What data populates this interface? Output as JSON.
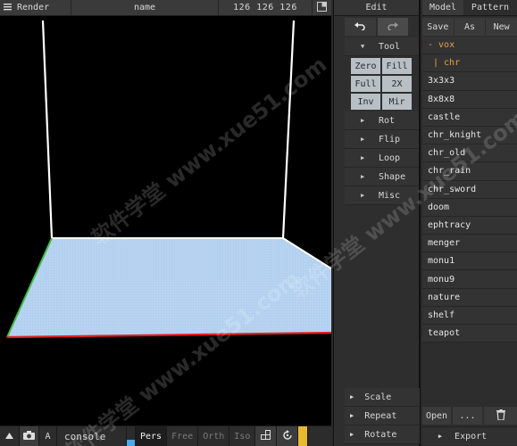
{
  "topbar": {
    "render_label": "Render",
    "name_label": "name",
    "dims": "126 126 126"
  },
  "bottombar": {
    "a_label": "A",
    "console_label": "console",
    "modes": [
      "Pers",
      "Free",
      "Orth",
      "Iso"
    ],
    "active_mode": "Pers"
  },
  "tools": {
    "title": "Edit",
    "tool_section": "Tool",
    "tool_buttons": [
      "Zero",
      "Fill",
      "Full",
      "2X",
      "Inv",
      "Mir"
    ],
    "sections": [
      "Rot",
      "Flip",
      "Loop",
      "Shape",
      "Misc"
    ],
    "bottom_sections": [
      "Scale",
      "Repeat",
      "Rotate"
    ]
  },
  "models": {
    "tab_model": "Model",
    "tab_pattern": "Pattern",
    "save_label": "Save",
    "as_label": "As",
    "new_label": "New",
    "items": [
      "- vox",
      "| chr",
      "3x3x3",
      "8x8x8",
      "castle",
      "chr_knight",
      "chr_old",
      "chr_rain",
      "chr_sword",
      "doom",
      "ephtracy",
      "menger",
      "monu1",
      "monu9",
      "nature",
      "shelf",
      "teapot"
    ],
    "open_label": "Open",
    "more_label": "...",
    "export_label": "Export"
  },
  "colors": {
    "floor": "#b8d4f2",
    "accent_blue": "#4aa8e8",
    "accent_yellow": "#e8b830",
    "folder_orange": "#e8a040",
    "x_axis": "#e02020",
    "z_axis": "#40c040"
  },
  "watermark": "软件学堂 www.xue51.com"
}
